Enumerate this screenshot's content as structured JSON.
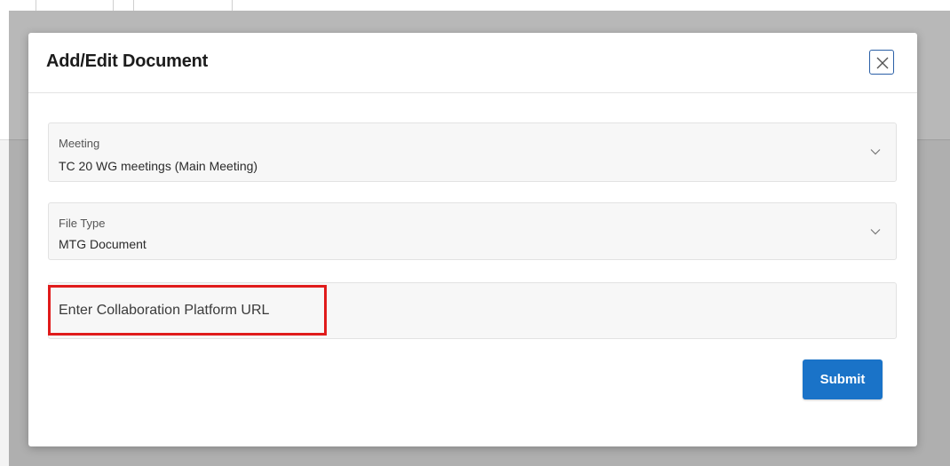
{
  "dialog": {
    "title": "Add/Edit Document",
    "close_icon": "close-icon"
  },
  "fields": {
    "meeting": {
      "label": "Meeting",
      "value": "TC 20 WG meetings (Main Meeting)",
      "icon": "chevron-down-icon"
    },
    "file_type": {
      "label": "File Type",
      "value": "MTG Document",
      "icon": "chevron-down-icon"
    },
    "url": {
      "placeholder": "Enter Collaboration Platform URL",
      "value": ""
    }
  },
  "actions": {
    "submit_label": "Submit"
  },
  "colors": {
    "primary": "#1a73c8",
    "highlight": "#e01b1b",
    "close_border": "#2a5fa6"
  }
}
